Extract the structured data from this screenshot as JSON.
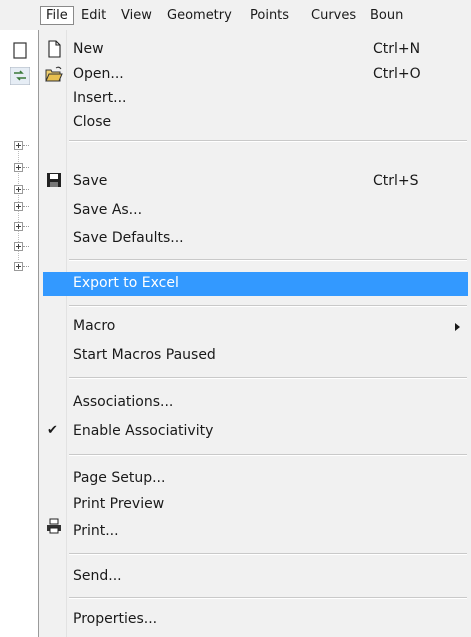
{
  "menubar": {
    "items": [
      "File",
      "Edit",
      "View",
      "Geometry",
      "Points",
      "Curves",
      "Boun"
    ]
  },
  "file_menu": {
    "new": {
      "label": "New",
      "accel": "Ctrl+N",
      "icon": "new-document-icon"
    },
    "open": {
      "label": "Open...",
      "accel": "Ctrl+O",
      "icon": "open-folder-icon"
    },
    "insert": {
      "label": "Insert..."
    },
    "close": {
      "label": "Close"
    },
    "save": {
      "label": "Save",
      "accel": "Ctrl+S",
      "icon": "floppy-disk-icon"
    },
    "save_as": {
      "label": "Save As..."
    },
    "save_defaults": {
      "label": "Save Defaults..."
    },
    "export_excel": {
      "label": "Export to Excel",
      "highlighted": true
    },
    "macro": {
      "label": "Macro",
      "has_submenu": true
    },
    "start_macros_paused": {
      "label": "Start Macros Paused"
    },
    "associations": {
      "label": "Associations..."
    },
    "enable_associativity": {
      "label": "Enable Associativity",
      "checked": true,
      "check_glyph": "✔"
    },
    "page_setup": {
      "label": "Page Setup..."
    },
    "print_preview": {
      "label": "Print Preview"
    },
    "print": {
      "label": "Print...",
      "icon": "printer-icon"
    },
    "send": {
      "label": "Send..."
    },
    "properties": {
      "label": "Properties..."
    }
  },
  "colors": {
    "highlight": "#3399ff",
    "menu_background": "#f1f1f1"
  }
}
